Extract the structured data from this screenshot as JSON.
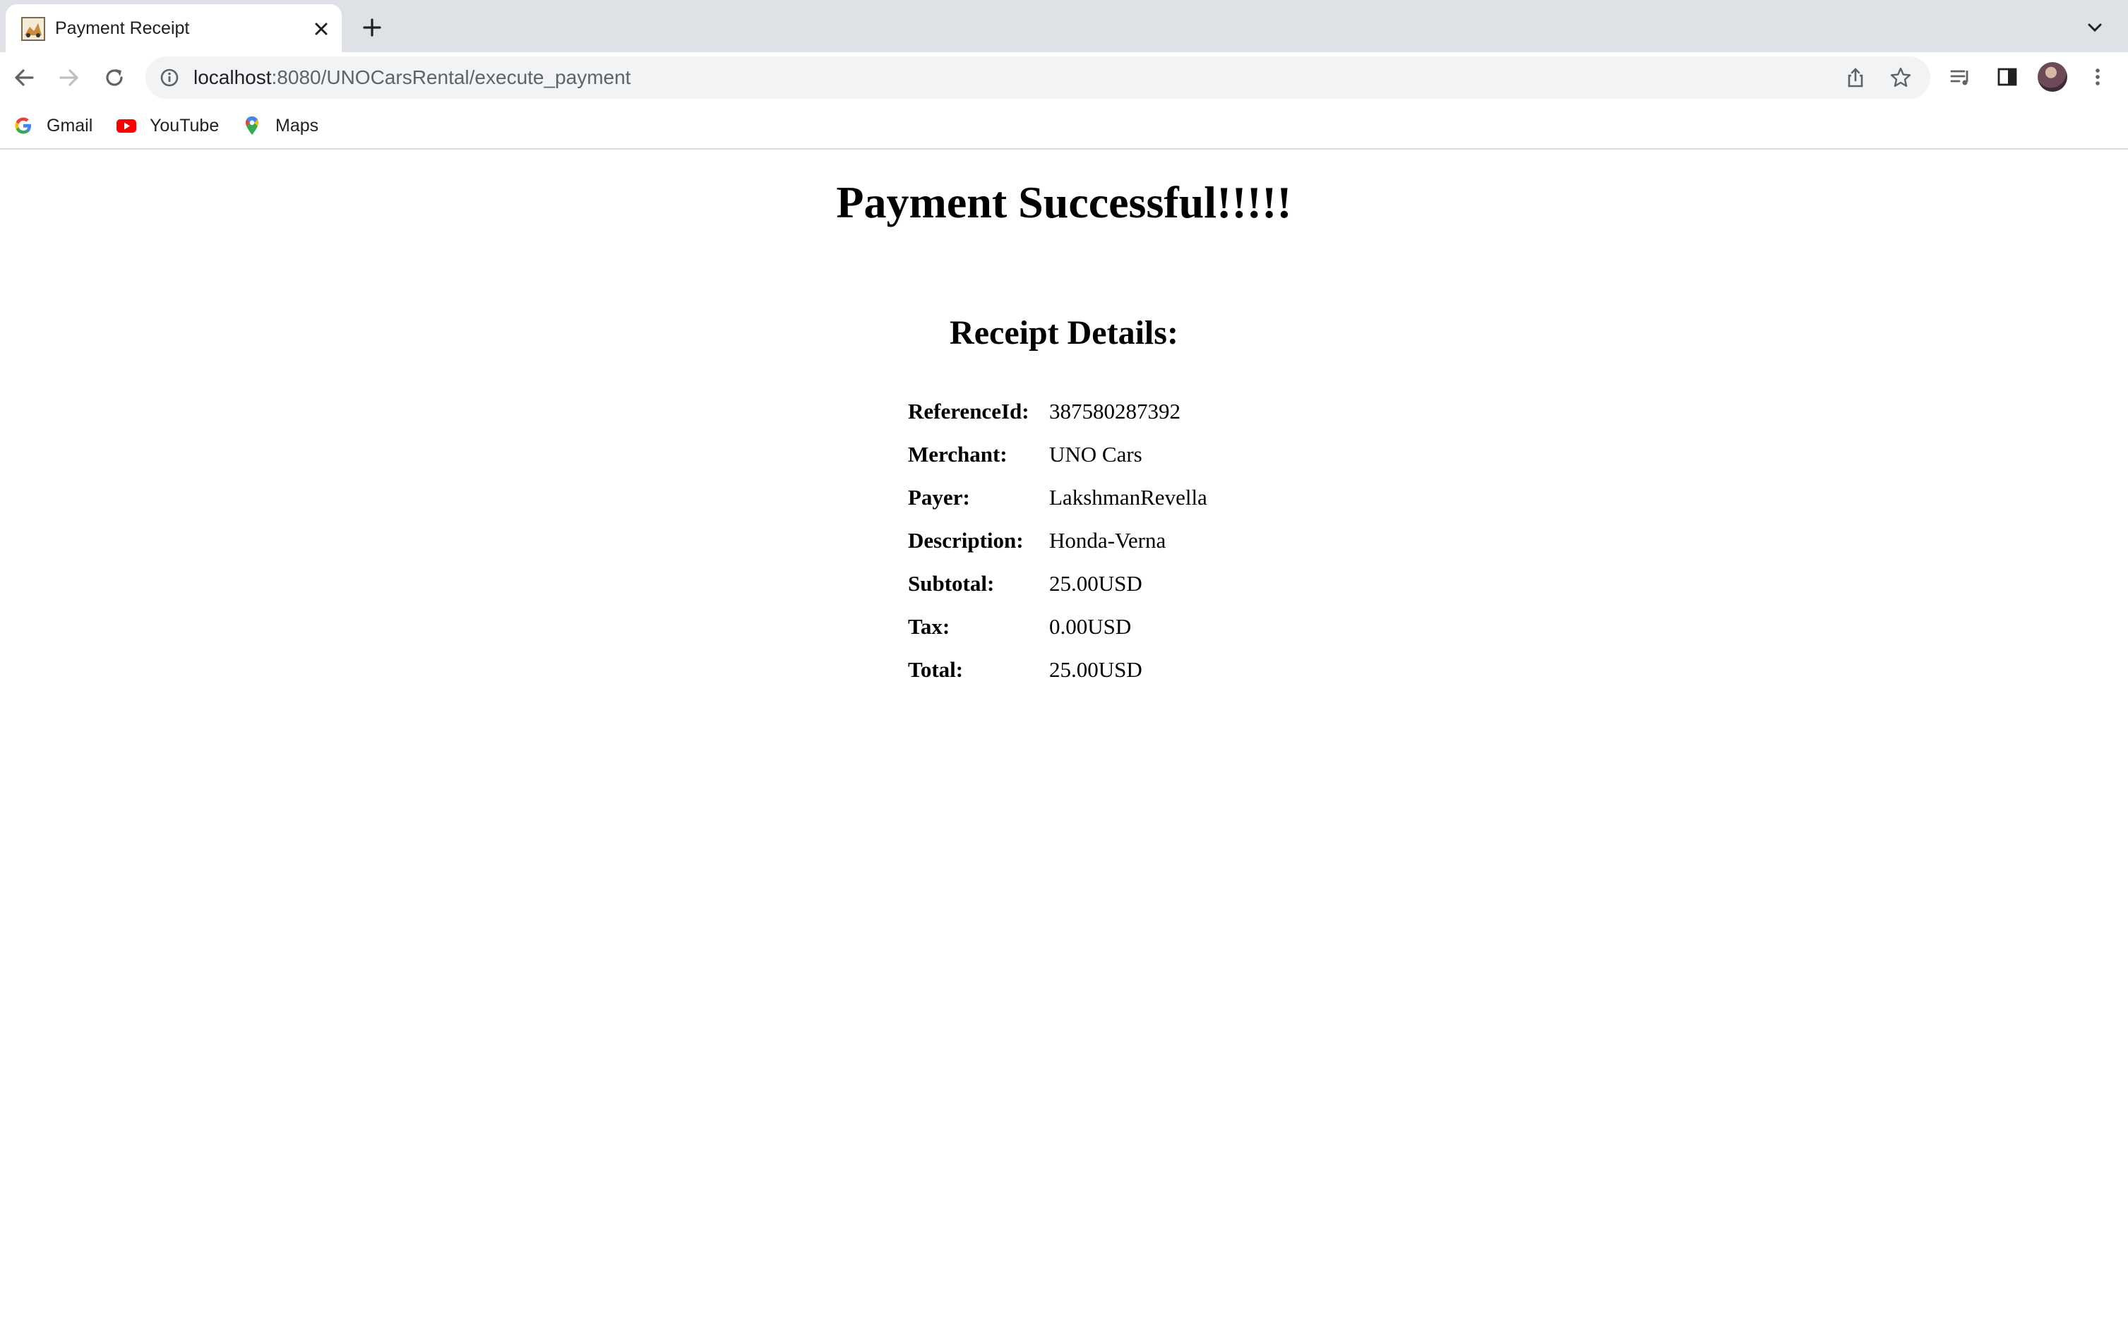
{
  "browser": {
    "tab": {
      "title": "Payment Receipt"
    },
    "address_bar": {
      "host": "localhost",
      "path": ":8080/UNOCarsRental/execute_payment"
    },
    "bookmarks": [
      {
        "label": "Gmail",
        "icon": "google-icon"
      },
      {
        "label": "YouTube",
        "icon": "youtube-icon"
      },
      {
        "label": "Maps",
        "icon": "maps-icon"
      }
    ]
  },
  "page": {
    "title": "Payment Successful!!!!!",
    "receipt_heading": "Receipt Details:",
    "receipt": [
      {
        "label": "ReferenceId:",
        "value": "387580287392"
      },
      {
        "label": "Merchant:",
        "value": "UNO Cars"
      },
      {
        "label": "Payer:",
        "value": "LakshmanRevella"
      },
      {
        "label": "Description:",
        "value": "Honda-Verna"
      },
      {
        "label": "Subtotal:",
        "value": "25.00USD"
      },
      {
        "label": "Tax:",
        "value": "0.00USD"
      },
      {
        "label": "Total:",
        "value": "25.00USD"
      }
    ]
  },
  "colors": {
    "tabstrip_bg": "#dee1e6",
    "omnibox_bg": "#f1f3f4",
    "text": "#202124"
  }
}
